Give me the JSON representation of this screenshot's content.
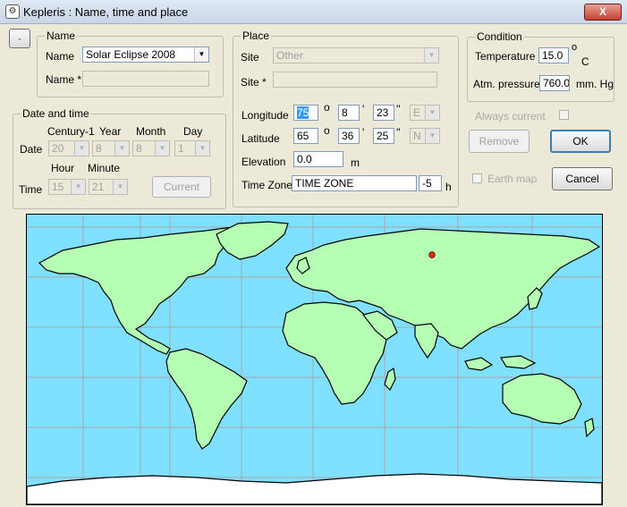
{
  "window": {
    "title": "Kepleris : Name, time and  place",
    "close_label": "X"
  },
  "tiny_button": {
    "label": "·"
  },
  "name_group": {
    "legend": "Name",
    "name_label": "Name",
    "name_value": "Solar Eclipse 2008",
    "name2_label": "Name *",
    "name2_value": ""
  },
  "date_group": {
    "legend": "Date and time",
    "century_label": "Century-1",
    "year_label": "Year",
    "month_label": "Month",
    "day_label": "Day",
    "date_label": "Date",
    "century_value": "20",
    "year_value": "8",
    "month_value": "8",
    "day_value": "1",
    "hour_label": "Hour",
    "minute_label": "Minute",
    "time_label": "Time",
    "hour_value": "15",
    "minute_value": "21",
    "current_label": "Current"
  },
  "place_group": {
    "legend": "Place",
    "site_label": "Site",
    "site_value": "Other",
    "site2_label": "Site *",
    "site2_value": "",
    "longitude_label": "Longitude",
    "lon_deg": "75",
    "lon_min": "8",
    "lon_sec": "23",
    "lon_dir": "E",
    "latitude_label": "Latitude",
    "lat_deg": "65",
    "lat_min": "36",
    "lat_sec": "25",
    "lat_dir": "N",
    "deg_symbol": "o",
    "min_symbol": "'",
    "sec_symbol": "''",
    "elevation_label": "Elevation",
    "elevation_value": "0.0",
    "elevation_unit": "m",
    "timezone_label": "Time Zone",
    "timezone_value": "TIME ZONE",
    "timezone_offset": "-5",
    "timezone_unit": "h"
  },
  "condition_group": {
    "legend": "Condition",
    "temperature_label": "Temperature",
    "temperature_value": "15.0",
    "temperature_unit_deg": "o",
    "temperature_unit": "C",
    "pressure_label": "Atm. pressure",
    "pressure_value": "760.0",
    "pressure_unit": "mm. Hg"
  },
  "options": {
    "always_current_label": "Always current",
    "remove_label": "Remove",
    "ok_label": "OK",
    "earth_map_label": "Earth map",
    "cancel_label": "Cancel"
  },
  "colors": {
    "ocean": "#7fe0ff",
    "land": "#b4ffb4",
    "marker": "#ff2a00",
    "selection": "#3399ff"
  }
}
